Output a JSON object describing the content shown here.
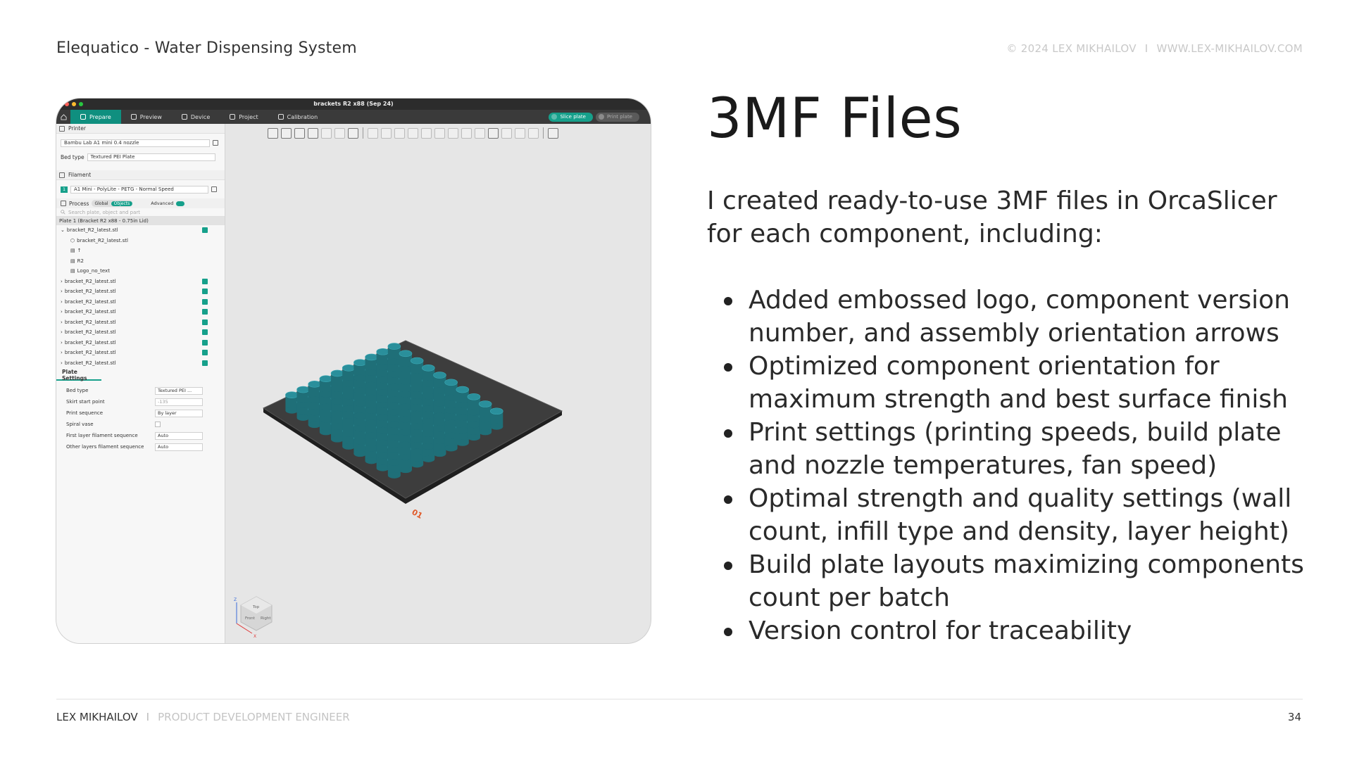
{
  "header": {
    "title": "Elequatico - Water Dispensing System",
    "copyright": "© 2024 LEX MIKHAILOV",
    "separator": "I",
    "website": "WWW.LEX-MIKHAILOV.COM"
  },
  "app": {
    "window_title": "brackets R2 x88 (Sep 24)",
    "tabs": [
      "Prepare",
      "Preview",
      "Device",
      "Project",
      "Calibration"
    ],
    "slice_label": "Slice plate",
    "print_label": "Print plate",
    "printer_section": "Printer",
    "printer_value": "Bambu Lab A1 mini 0.4 nozzle",
    "bed_type_label": "Bed type",
    "bed_type_value": "Textured PEI Plate",
    "filament_section": "Filament",
    "filament_slot": "1",
    "filament_value": "A1 Mini - PolyLite - PETG - Normal Speed",
    "process_label": "Process",
    "global_label": "Global",
    "objects_label": "Objects",
    "advanced_label": "Advanced",
    "search_placeholder": "Search plate, object and part",
    "plate_label": "Plate 1 (Bracket R2 x88 - 0.75in Lid)",
    "objects": [
      "bracket_R2_latest.stl",
      "bracket_R2_latest.stl",
      "bracket_R2_latest.stl",
      "bracket_R2_latest.stl",
      "bracket_R2_latest.stl",
      "bracket_R2_latest.stl",
      "bracket_R2_latest.stl",
      "bracket_R2_latest.stl",
      "bracket_R2_latest.stl",
      "bracket_R2_latest.stl"
    ],
    "subparts": [
      "bracket_R2_latest.stl",
      "↑",
      "R2",
      "Logo_no_text"
    ],
    "plate_settings_title": "Plate Settings",
    "plate_settings": [
      {
        "label": "Bed type",
        "value": "Textured PEI ..."
      },
      {
        "label": "Skirt start point",
        "value": "-135"
      },
      {
        "label": "Print sequence",
        "value": "By layer"
      },
      {
        "label": "Spiral vase",
        "value": ""
      },
      {
        "label": "First layer filament sequence",
        "value": "Auto"
      },
      {
        "label": "Other layers filament sequence",
        "value": "Auto"
      }
    ],
    "plate_number": "01",
    "cube_labels": {
      "top": "Top",
      "front": "Front",
      "right": "Right",
      "z": "Z",
      "x": "X"
    },
    "colors": {
      "accent": "#16a08b",
      "part": "#2a8f9b"
    }
  },
  "slide": {
    "heading": "3MF Files",
    "intro": "I created ready-to-use 3MF files in OrcaSlicer for each component, including:",
    "bullets": [
      "Added embossed logo, component version number, and assembly orientation arrows",
      "Optimized component orientation for maximum strength and best surface finish",
      "Print settings (printing speeds, build plate and nozzle temperatures, fan speed)",
      "Optimal strength and quality settings (wall count, infill type and density, layer height)",
      "Build plate layouts maximizing components count per batch",
      "Version control for traceability"
    ]
  },
  "footer": {
    "name": "LEX MIKHAILOV",
    "separator": "I",
    "role": "PRODUCT DEVELOPMENT ENGINEER",
    "page": "34"
  }
}
